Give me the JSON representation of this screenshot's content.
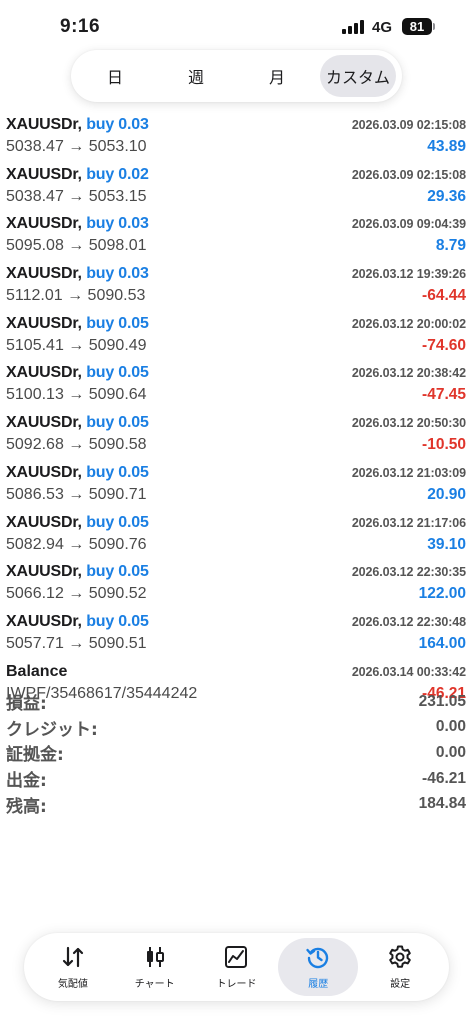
{
  "status_bar": {
    "time": "9:16",
    "network": "4G",
    "battery": "81"
  },
  "period_tabs": [
    {
      "label": "日",
      "active": false
    },
    {
      "label": "週",
      "active": false
    },
    {
      "label": "月",
      "active": false
    },
    {
      "label": "カスタム",
      "active": true
    }
  ],
  "deals": [
    {
      "symbol": "XAUUSDr,",
      "side": "buy 0.03",
      "time": "2026.03.09 02:15:08",
      "prices": "5038.47 → 5053.10",
      "profit": "43.89",
      "sign": "pos"
    },
    {
      "symbol": "XAUUSDr,",
      "side": "buy 0.02",
      "time": "2026.03.09 02:15:08",
      "prices": "5038.47 → 5053.15",
      "profit": "29.36",
      "sign": "pos"
    },
    {
      "symbol": "XAUUSDr,",
      "side": "buy 0.03",
      "time": "2026.03.09 09:04:39",
      "prices": "5095.08 → 5098.01",
      "profit": "8.79",
      "sign": "pos"
    },
    {
      "symbol": "XAUUSDr,",
      "side": "buy 0.03",
      "time": "2026.03.12 19:39:26",
      "prices": "5112.01 → 5090.53",
      "profit": "-64.44",
      "sign": "neg"
    },
    {
      "symbol": "XAUUSDr,",
      "side": "buy 0.05",
      "time": "2026.03.12 20:00:02",
      "prices": "5105.41 → 5090.49",
      "profit": "-74.60",
      "sign": "neg"
    },
    {
      "symbol": "XAUUSDr,",
      "side": "buy 0.05",
      "time": "2026.03.12 20:38:42",
      "prices": "5100.13 → 5090.64",
      "profit": "-47.45",
      "sign": "neg"
    },
    {
      "symbol": "XAUUSDr,",
      "side": "buy 0.05",
      "time": "2026.03.12 20:50:30",
      "prices": "5092.68 → 5090.58",
      "profit": "-10.50",
      "sign": "neg"
    },
    {
      "symbol": "XAUUSDr,",
      "side": "buy 0.05",
      "time": "2026.03.12 21:03:09",
      "prices": "5086.53 → 5090.71",
      "profit": "20.90",
      "sign": "pos"
    },
    {
      "symbol": "XAUUSDr,",
      "side": "buy 0.05",
      "time": "2026.03.12 21:17:06",
      "prices": "5082.94 → 5090.76",
      "profit": "39.10",
      "sign": "pos"
    },
    {
      "symbol": "XAUUSDr,",
      "side": "buy 0.05",
      "time": "2026.03.12 22:30:35",
      "prices": "5066.12 → 5090.52",
      "profit": "122.00",
      "sign": "pos"
    },
    {
      "symbol": "XAUUSDr,",
      "side": "buy 0.05",
      "time": "2026.03.12 22:30:48",
      "prices": "5057.71 → 5090.51",
      "profit": "164.00",
      "sign": "pos"
    }
  ],
  "balance": {
    "label": "Balance",
    "time": "2026.03.14 00:33:42",
    "comment": "IWPF/35468617/35444242",
    "amount": "-46.21"
  },
  "summary": [
    {
      "label": "損益:",
      "value": "231.05"
    },
    {
      "label": "クレジット:",
      "value": "0.00"
    },
    {
      "label": "証拠金:",
      "value": "0.00"
    },
    {
      "label": "出金:",
      "value": "-46.21"
    },
    {
      "label": "残高:",
      "value": "184.84"
    }
  ],
  "tabbar": [
    {
      "label": "気配値",
      "icon": "quotes-arrows-icon",
      "active": false
    },
    {
      "label": "チャート",
      "icon": "candlestick-chart-icon",
      "active": false
    },
    {
      "label": "トレード",
      "icon": "trade-line-chart-icon",
      "active": false
    },
    {
      "label": "履歴",
      "icon": "history-clock-icon",
      "active": true
    },
    {
      "label": "設定",
      "icon": "gear-icon",
      "active": false
    }
  ],
  "colors": {
    "buy": "#1a7fe3",
    "profit_positive": "#1a7fe3",
    "profit_negative": "#e0352b",
    "active_tab": "#1a7fe3"
  }
}
